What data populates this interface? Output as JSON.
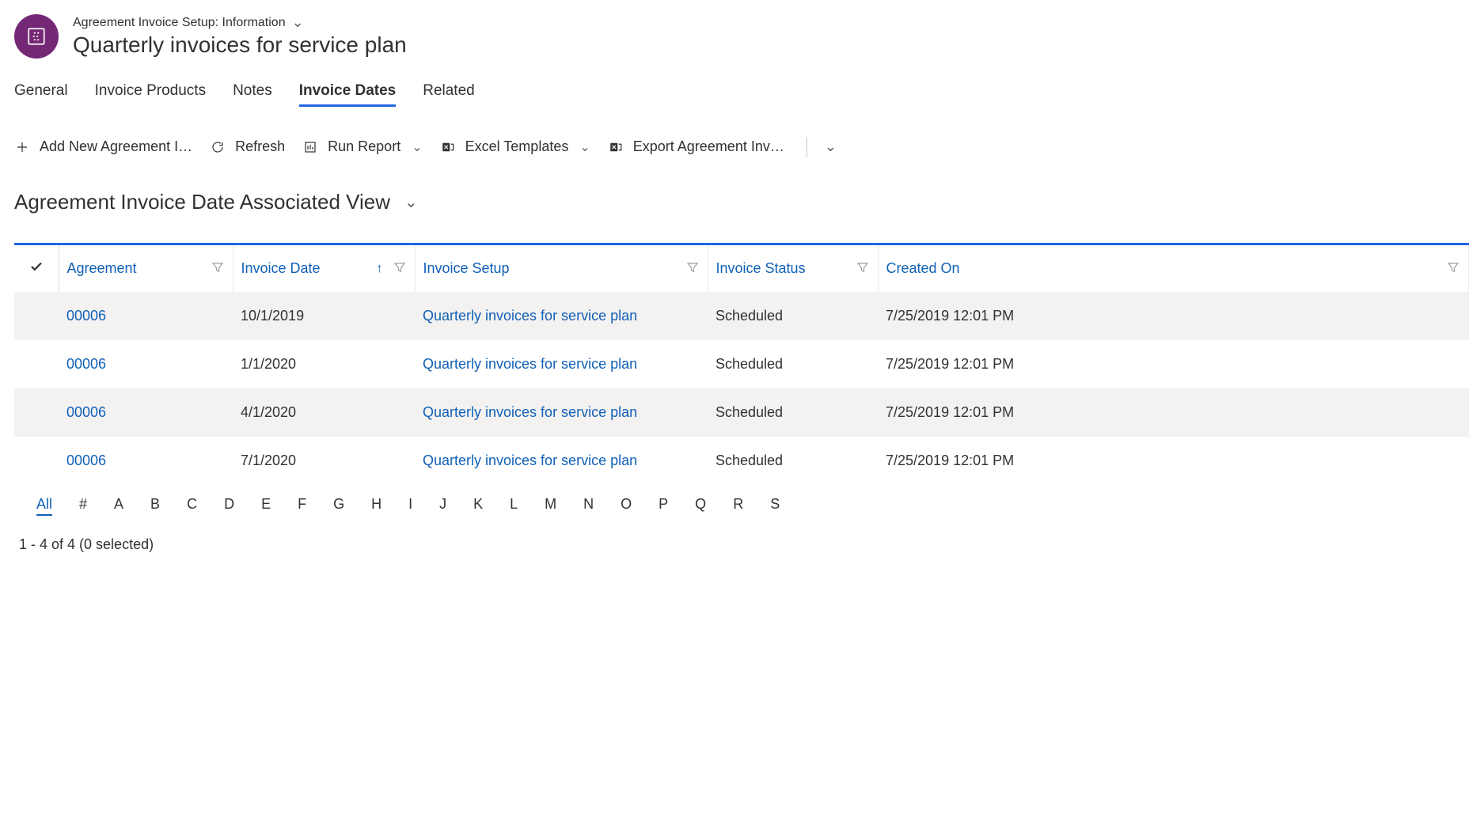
{
  "header": {
    "breadcrumb": "Agreement Invoice Setup: Information",
    "title": "Quarterly invoices for service plan"
  },
  "tabs": [
    {
      "label": "General",
      "active": false
    },
    {
      "label": "Invoice Products",
      "active": false
    },
    {
      "label": "Notes",
      "active": false
    },
    {
      "label": "Invoice Dates",
      "active": true
    },
    {
      "label": "Related",
      "active": false
    }
  ],
  "commands": {
    "add": "Add New Agreement I…",
    "refresh": "Refresh",
    "run_report": "Run Report",
    "excel_templates": "Excel Templates",
    "export": "Export Agreement Inv…"
  },
  "view": {
    "title": "Agreement Invoice Date Associated View"
  },
  "columns": {
    "agreement": "Agreement",
    "invoice_date": "Invoice Date",
    "invoice_setup": "Invoice Setup",
    "invoice_status": "Invoice Status",
    "created_on": "Created On"
  },
  "rows": [
    {
      "agreement": "00006",
      "invoice_date": "10/1/2019",
      "invoice_setup": "Quarterly invoices for service plan",
      "invoice_status": "Scheduled",
      "created_on": "7/25/2019 12:01 PM"
    },
    {
      "agreement": "00006",
      "invoice_date": "1/1/2020",
      "invoice_setup": "Quarterly invoices for service plan",
      "invoice_status": "Scheduled",
      "created_on": "7/25/2019 12:01 PM"
    },
    {
      "agreement": "00006",
      "invoice_date": "4/1/2020",
      "invoice_setup": "Quarterly invoices for service plan",
      "invoice_status": "Scheduled",
      "created_on": "7/25/2019 12:01 PM"
    },
    {
      "agreement": "00006",
      "invoice_date": "7/1/2020",
      "invoice_setup": "Quarterly invoices for service plan",
      "invoice_status": "Scheduled",
      "created_on": "7/25/2019 12:01 PM"
    }
  ],
  "alpha_filter": [
    "All",
    "#",
    "A",
    "B",
    "C",
    "D",
    "E",
    "F",
    "G",
    "H",
    "I",
    "J",
    "K",
    "L",
    "M",
    "N",
    "O",
    "P",
    "Q",
    "R",
    "S"
  ],
  "alpha_active": "All",
  "status_text": "1 - 4 of 4 (0 selected)"
}
